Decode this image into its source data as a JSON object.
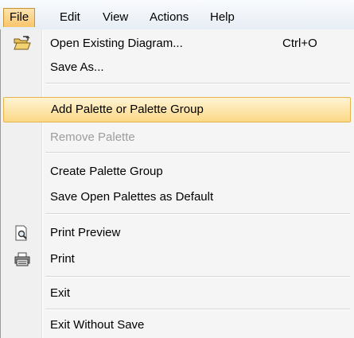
{
  "menubar": {
    "items": [
      {
        "label": "File"
      },
      {
        "label": "Edit"
      },
      {
        "label": "View"
      },
      {
        "label": "Actions"
      },
      {
        "label": "Help"
      }
    ]
  },
  "menu": {
    "open_existing": {
      "label": "Open Existing Diagram...",
      "shortcut": "Ctrl+O",
      "icon": "open-folder-icon"
    },
    "save_as": {
      "label": "Save As..."
    },
    "add_palette": {
      "label": "Add Palette or Palette Group"
    },
    "remove_palette": {
      "label": "Remove Palette"
    },
    "create_group": {
      "label": "Create Palette Group"
    },
    "save_default": {
      "label": "Save Open Palettes as Default"
    },
    "print_preview": {
      "label": "Print Preview",
      "icon": "print-preview-icon"
    },
    "print": {
      "label": "Print",
      "icon": "printer-icon"
    },
    "exit": {
      "label": "Exit"
    },
    "exit_without_save": {
      "label": "Exit Without Save"
    }
  },
  "colors": {
    "highlight": "#fbd886",
    "disabled_text": "#9d9d9d",
    "menu_background": "#f5f5f5"
  }
}
